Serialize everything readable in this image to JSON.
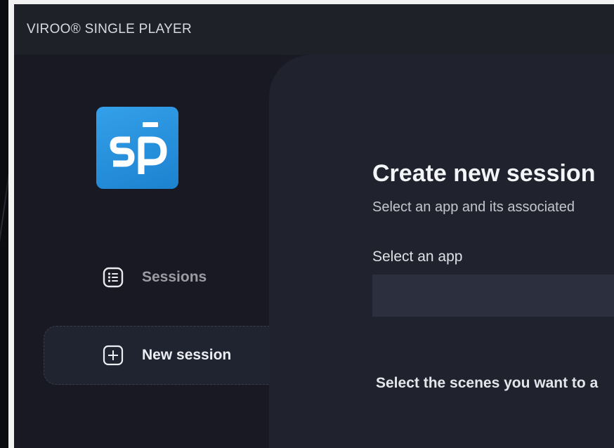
{
  "window": {
    "title": "VIROO® SINGLE PLAYER"
  },
  "sidebar": {
    "logo_text": "sp̄",
    "items": [
      {
        "label": "Sessions",
        "icon": "list-icon",
        "active": false
      },
      {
        "label": "New session",
        "icon": "plus-square-icon",
        "active": true
      }
    ]
  },
  "main": {
    "title": "Create new session",
    "subtitle": "Select an app and its associated",
    "select_app_label": "Select an app",
    "select_app_value": "",
    "scenes_label": "Select the scenes you want to a"
  },
  "colors": {
    "background": "#191a24",
    "title_bar": "#1f2128",
    "panel": "#20222e",
    "logo_blue": "#2a91dd",
    "input": "#2c2f3d"
  }
}
